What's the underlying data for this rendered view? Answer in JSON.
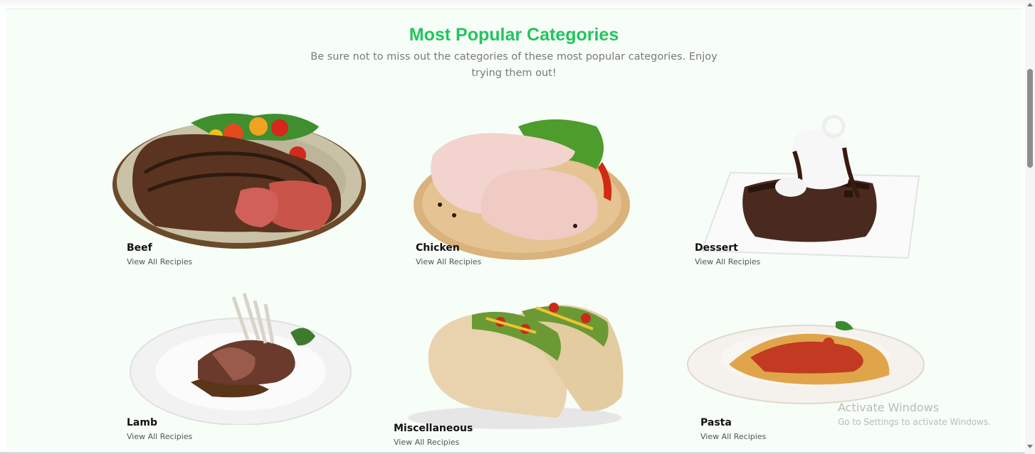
{
  "section": {
    "title": "Most Popular Categories",
    "subtitle": "Be sure not to miss out the categories of these most popular categories. Enjoy trying them out!"
  },
  "categories": [
    {
      "name": "Beef",
      "link": "View All Recipies",
      "icon": "beef-steak-image"
    },
    {
      "name": "Chicken",
      "link": "View All Recipies",
      "icon": "chicken-legs-image"
    },
    {
      "name": "Dessert",
      "link": "View All Recipies",
      "icon": "chocolate-cake-image"
    },
    {
      "name": "Lamb",
      "link": "View All Recipies",
      "icon": "lamb-chops-image"
    },
    {
      "name": "Miscellaneous",
      "link": "View All Recipies",
      "icon": "tacos-image"
    },
    {
      "name": "Pasta",
      "link": "View All Recipies",
      "icon": "pasta-bowl-image"
    }
  ],
  "watermark": {
    "line1": "Activate Windows",
    "line2": "Go to Settings to activate Windows."
  },
  "colors": {
    "accent": "#22c55e",
    "background": "#f7fdf7"
  }
}
